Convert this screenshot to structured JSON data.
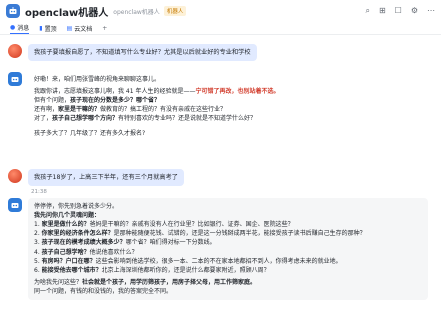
{
  "header": {
    "title": "openclaw机器人",
    "subtitle": "openclaw机器人",
    "tag": "机器人",
    "icons": [
      "search-icon",
      "more-icon",
      "chat-icon",
      "settings-icon",
      "ellipsis-icon"
    ]
  },
  "tabs": [
    {
      "icon": "chat-icon",
      "label": "消息"
    },
    {
      "icon": "pin-icon",
      "label": "置顶"
    },
    {
      "icon": "doc-icon",
      "label": "云文档"
    },
    {
      "icon": "plus-icon",
      "label": "+"
    }
  ],
  "messages": {
    "m1": "我孩子要填报自愿了，不知道填写什么专业好？尤其是以后就业好的专业和学校",
    "m2": {
      "line1": "好嘞！来，咱们用张雪峰的视角来聊聊这事儿。",
      "line2_a": "我跟你讲，志愿填报这事儿啊，我 41 年人生的经验就是——",
      "line2_b": "宁可错了再改，也别站着不选。",
      "line3_a": "但有个问题，",
      "line3_b": "孩子现在的分数是多少？哪个省？",
      "line4_a": "还有啊，",
      "line4_b": "家里是干嘛的？",
      "line4_c": "做教育的？搞工程的？有没有亲戚在这些行业？",
      "line5_a": "对了，",
      "line5_b": "孩子自己想学哪个方向？",
      "line5_c": "有特别喜欢的专业吗？还是说就是不知道学什么好？"
    },
    "m3": "孩子多大了？几年级了？还有多久才报名?",
    "m4": "我孩子18岁了，上高三下半年，还有三个月就高考了",
    "time": "21:38",
    "m5": {
      "intro1": "停停停，你先别急着说多少分。",
      "intro2": "我先问你几个灵魂问题：",
      "items": [
        {
          "no": "1.",
          "q": "家里是做什么的？",
          "rest": "爸妈是干嘛的？亲戚有没有人在行业里？比如银行、证券、国企、医院这些？"
        },
        {
          "no": "2.",
          "q": "你家里的经济条件怎么样？",
          "rest": "是那种能随便花钱、试错的，还是这一分钱掰成两半花，能接受孩子读书后赚自己生存的那种？"
        },
        {
          "no": "3.",
          "q": "孩子现在的模考成绩大概多少？",
          "rest": "哪个省？咱们得对标一下分数线。"
        },
        {
          "no": "4.",
          "q": "孩子自己想学啥？",
          "rest": "他说他喜欢什么？"
        },
        {
          "no": "5.",
          "q": "有房吗？户口在哪？",
          "rest": "这些会影响到他选学校，很多一本、二本的不在家本地都招不到人，你得考虑未来的就业地。"
        },
        {
          "no": "6.",
          "q": "能接受他去哪个城市？",
          "rest": "北京上海深圳他都听你的，还是说什么都要家附近，照顾八周？"
        }
      ],
      "outro1_a": "为啥我先问这些？",
      "outro1_b": "社会就是个孩子，用学历筛孩子，用房子择父母，用工作筛家庭。",
      "outro2": "同一个问题，有钱的和没钱的，我的答案完全不同。"
    }
  }
}
